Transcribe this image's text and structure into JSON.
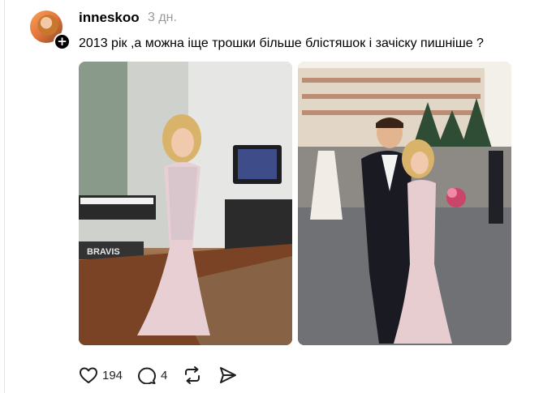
{
  "post": {
    "username": "inneskoo",
    "time": "3 дн.",
    "text": "2013 рік ,а можна іще трошки більше блістяшок і зачіску пишніше ?",
    "follow_badge": "+",
    "photo_1_sign": "BRAVIS"
  },
  "actions": {
    "likes": "194",
    "replies": "4"
  },
  "icons": {
    "like": "heart-icon",
    "reply": "comment-bubble-icon",
    "repost": "repost-icon",
    "share": "send-icon"
  }
}
